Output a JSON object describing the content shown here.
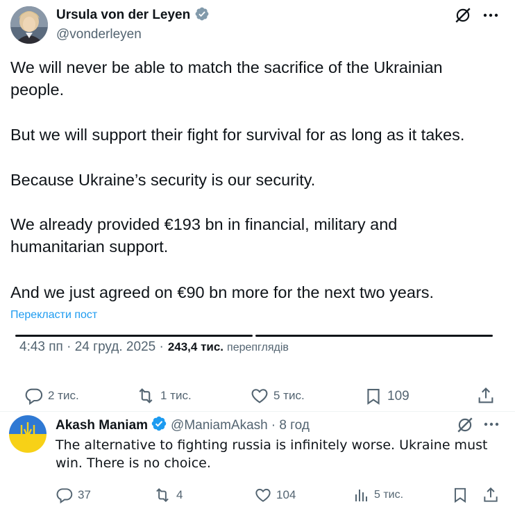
{
  "main_tweet": {
    "author_name": "Ursula von der Leyen",
    "handle": "@vonderleyen",
    "paragraphs": [
      "We will never be able to match the sacrifice of the Ukrainian people.",
      "But we will support their fight for survival for as long as it takes.",
      "Because Ukraine’s security is our security.",
      "We already provided €193 bn in financial, military and humanitarian support.",
      "And we just agreed on €90 bn more for the next two years."
    ],
    "translate_label": "Перекласти пост",
    "timestamp": "4:43 пп · 24 груд. 2025 ·",
    "views_count": "243,4 тис.",
    "views_label": "перепглядів",
    "actions": {
      "replies": "2 тис.",
      "reposts": "1 тис.",
      "likes": "5 тис.",
      "bookmarks": "109"
    }
  },
  "reply_tweet": {
    "author_name": "Akash Maniam",
    "handle": "@ManiamAkash",
    "time": "· 8 год",
    "text": "The alternative to fighting russia is infinitely worse. Ukraine must win. There is no choice.",
    "actions": {
      "replies": "37",
      "reposts": "4",
      "likes": "104",
      "views": "5 тис."
    }
  },
  "colors": {
    "accent": "#1d9bf0",
    "text": "#0f1419",
    "muted": "#536471",
    "verified": "#1d9bf0"
  },
  "icons": [
    "grok-icon",
    "more-icon",
    "verified-badge-icon",
    "reply-icon",
    "repost-icon",
    "like-icon",
    "bookmark-icon",
    "share-icon",
    "views-icon"
  ]
}
